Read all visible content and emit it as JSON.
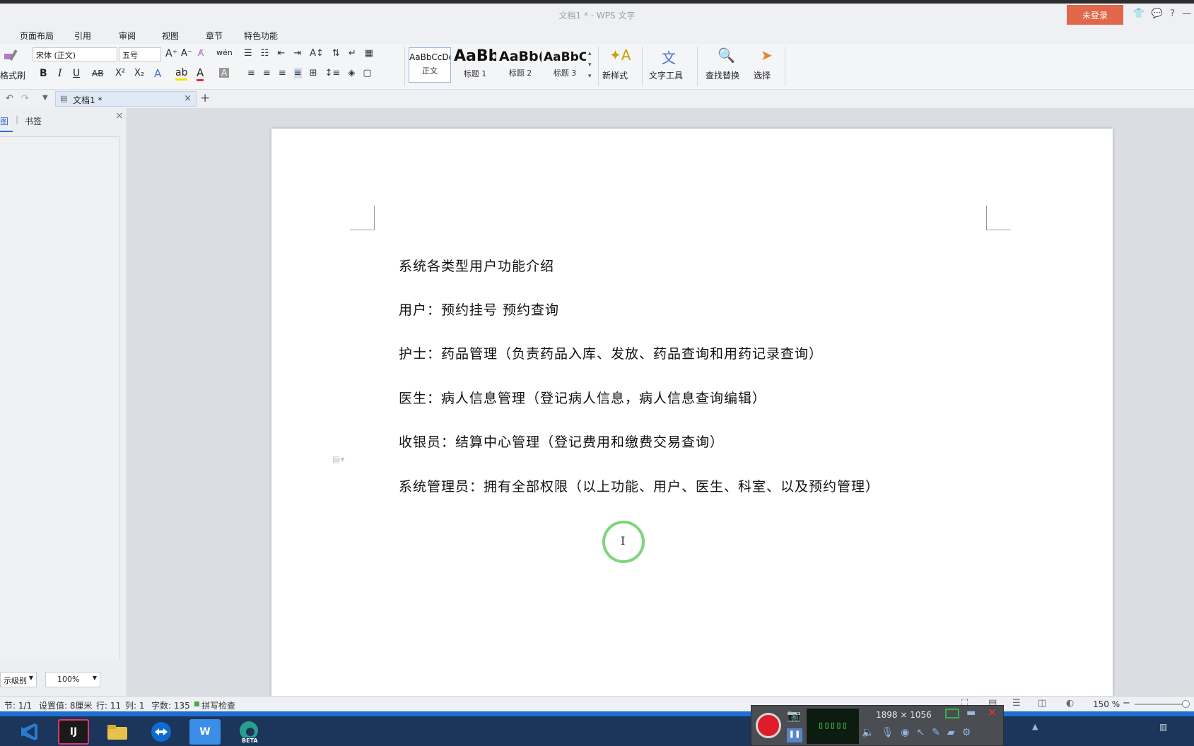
{
  "title": "文档1 * - WPS 文字",
  "login_button": "未登录",
  "menu": [
    "页面布局",
    "引用",
    "审阅",
    "视图",
    "章节",
    "特色功能"
  ],
  "ribbon": {
    "format_painter": "格式刷",
    "font_name": "宋体 (正文)",
    "font_size": "五号",
    "styles": [
      {
        "sample": "AaBbCcDd",
        "name": "正文"
      },
      {
        "sample": "AaBb",
        "name": "标题 1"
      },
      {
        "sample": "AaBb(",
        "name": "标题 2"
      },
      {
        "sample": "AaBbC",
        "name": "标题 3"
      }
    ],
    "new_style": "新样式",
    "text_tools": "文字工具",
    "find_replace": "查找替换",
    "select": "选择"
  },
  "tab": {
    "label": "文档1 *"
  },
  "left_panel": {
    "tab1": "图",
    "tab2": "书签",
    "level_select": "示级别",
    "zoom_select": "100%"
  },
  "document": {
    "lines": [
      "系统各类型用户功能介绍",
      "用户：预约挂号 预约查询",
      "护士：药品管理（负责药品入库、发放、药品查询和用药记录查询）",
      "医生：病人信息管理（登记病人信息，病人信息查询编辑）",
      "收银员：结算中心管理（登记费用和缴费交易查询）",
      "系统管理员：拥有全部权限（以上功能、用户、医生、科室、以及预约管理）"
    ]
  },
  "status": {
    "section": "节: 1/1",
    "setting": "设置值: 8厘米",
    "row": "行: 11",
    "col": "列: 1",
    "word_count": "字数: 135",
    "spell_check": "拼写检查",
    "zoom": "150 %"
  },
  "recorder": {
    "resolution": "1898 × 1056"
  },
  "taskbar": [
    {
      "name": "vscode",
      "label": "",
      "color": "#2b7bd1"
    },
    {
      "name": "intellij",
      "label": "IJ",
      "color": "#1a1a1a"
    },
    {
      "name": "folder",
      "label": "",
      "color": "#e9c04a"
    },
    {
      "name": "teamviewer",
      "label": "",
      "color": "#0e6bd0"
    },
    {
      "name": "wps",
      "label": "W",
      "color": "#3a8ee8"
    },
    {
      "name": "edge-beta",
      "label": "BETA",
      "color": "#2a9d8f"
    }
  ],
  "colors": {
    "accent": "#e0674a",
    "taskbar": "#1c355a",
    "status_blue": "#1f6fd1",
    "cursor_ring": "#7fd47a"
  }
}
